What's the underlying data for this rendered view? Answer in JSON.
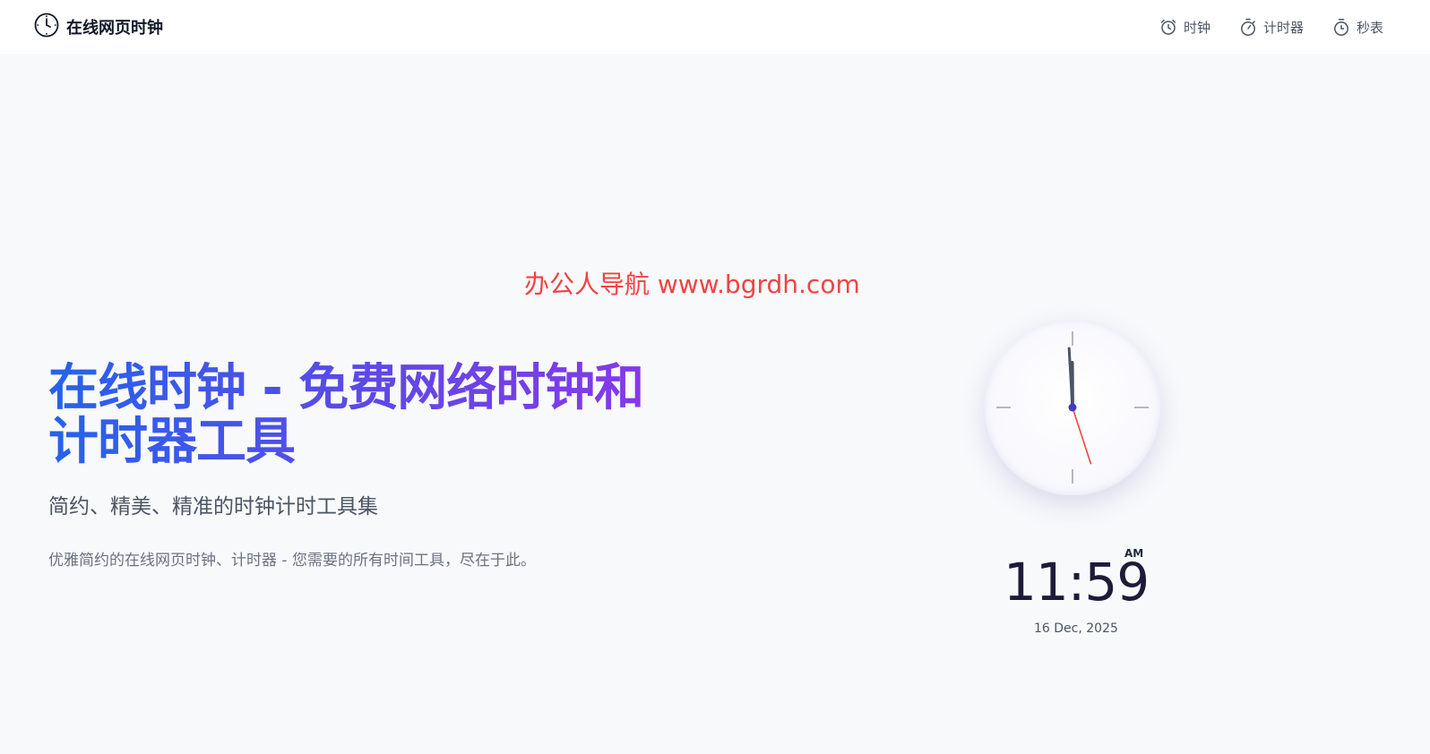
{
  "header": {
    "brand_title": "在线网页时钟",
    "brand_icon": "clock-icon",
    "nav": [
      {
        "label": "时钟",
        "icon": "alarm-clock-icon"
      },
      {
        "label": "计时器",
        "icon": "stopwatch-icon"
      },
      {
        "label": "秒表",
        "icon": "timer-icon"
      }
    ]
  },
  "watermark": "办公人导航  www.bgrdh.com",
  "hero": {
    "title_line1": "在线时钟 - 免费网络时钟和",
    "title_line2": "计时器工具",
    "subtitle": "简约、精美、精准的时钟计时工具集",
    "description": "优雅简约的在线网页时钟、计时器 - 您需要的所有时间工具，尽在于此。"
  },
  "clock": {
    "hour": 11,
    "minute": 59,
    "second": 27,
    "time_text": "11:59",
    "period": "AM",
    "date_text": "16 Dec, 2025"
  },
  "colors": {
    "accent_blue": "#2563eb",
    "accent_purple": "#9333ea",
    "second_hand": "#ef4444",
    "watermark": "#ef4444"
  }
}
